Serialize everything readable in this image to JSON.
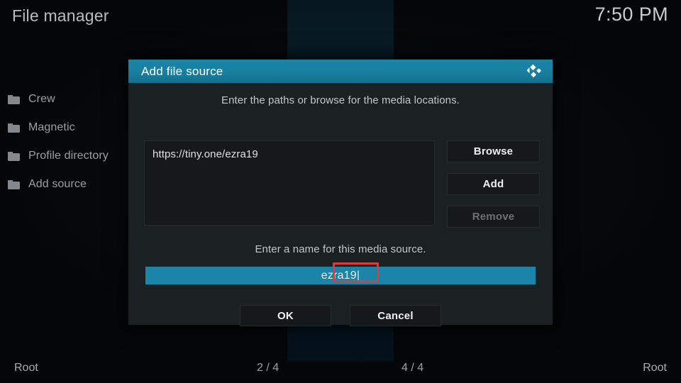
{
  "window": {
    "title": "File manager",
    "clock": "7:50 PM"
  },
  "sidebar": {
    "items": [
      {
        "label": "Crew",
        "icon": "folder-icon"
      },
      {
        "label": "Magnetic",
        "icon": "folder-icon"
      },
      {
        "label": "Profile directory",
        "icon": "folder-icon"
      },
      {
        "label": "Add source",
        "icon": "folder-icon"
      }
    ]
  },
  "footer": {
    "left": "Root",
    "left_count": "2 / 4",
    "right_count": "4 / 4",
    "right": "Root"
  },
  "dialog": {
    "title": "Add file source",
    "logo_icon": "kodi-logo-icon",
    "paths_hint": "Enter the paths or browse for the media locations.",
    "path_value": "https://tiny.one/ezra19",
    "buttons": {
      "browse": "Browse",
      "add": "Add",
      "remove": "Remove"
    },
    "name_hint": "Enter a name for this media source.",
    "name_value": "ezra19",
    "caret": "|",
    "ok": "OK",
    "cancel": "Cancel"
  },
  "colors": {
    "accent": "#1a85a8",
    "header": "#187f9f",
    "dialog_bg": "#1b2023",
    "field_bg": "#15191c",
    "highlight": "#e03b3b",
    "text": "#d8d8d8"
  }
}
